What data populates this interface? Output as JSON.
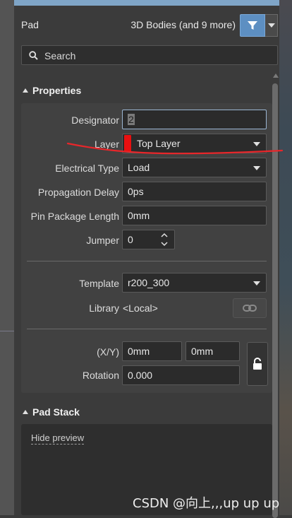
{
  "header": {
    "object_label": "Pad",
    "selection_label": "3D Bodies (and 9 more)",
    "filter_icon": "funnel-icon"
  },
  "search": {
    "placeholder": "Search",
    "icon": "search-icon"
  },
  "properties": {
    "title": "Properties",
    "designator": {
      "label": "Designator",
      "value": "2"
    },
    "layer": {
      "label": "Layer",
      "value": "Top Layer",
      "color": "#e81010"
    },
    "electrical_type": {
      "label": "Electrical Type",
      "value": "Load"
    },
    "propagation_delay": {
      "label": "Propagation Delay",
      "value": "0ps"
    },
    "pin_package_length": {
      "label": "Pin Package Length",
      "value": "0mm"
    },
    "jumper": {
      "label": "Jumper",
      "value": "0"
    },
    "template": {
      "label": "Template",
      "value": "r200_300"
    },
    "library": {
      "label": "Library",
      "value": "<Local>"
    },
    "xy": {
      "label": "(X/Y)",
      "x": "0mm",
      "y": "0mm"
    },
    "rotation": {
      "label": "Rotation",
      "value": "0.000"
    }
  },
  "pad_stack": {
    "title": "Pad Stack",
    "hide_preview": "Hide preview"
  },
  "watermark": "CSDN @向上,,,up up up",
  "colors": {
    "accent": "#5d8fc2",
    "annotation": "#e8262a",
    "panel_bg": "#3b3b3b"
  }
}
